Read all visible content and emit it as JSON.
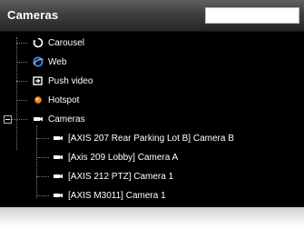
{
  "header": {
    "title": "Cameras",
    "search_value": ""
  },
  "tree": {
    "items": [
      {
        "label": "Carousel",
        "icon": "carousel-icon"
      },
      {
        "label": "Web",
        "icon": "web-icon"
      },
      {
        "label": "Push video",
        "icon": "push-video-icon"
      },
      {
        "label": "Hotspot",
        "icon": "hotspot-icon"
      },
      {
        "label": "Cameras",
        "icon": "camera-icon",
        "expanded": true,
        "children": [
          {
            "label": "[AXIS 207 Rear Parking Lot B] Camera B",
            "icon": "camera-icon"
          },
          {
            "label": "[Axis 209 Lobby] Camera A",
            "icon": "camera-icon"
          },
          {
            "label": "[AXIS 212 PTZ] Camera 1",
            "icon": "camera-icon"
          },
          {
            "label": "[AXIS M3011] Camera 1",
            "icon": "camera-icon"
          }
        ]
      }
    ]
  },
  "colors": {
    "panel_bg": "#000000",
    "text": "#ffffff",
    "web_icon": "#3d8fe0",
    "hotspot_icon": "#f08a1c"
  }
}
